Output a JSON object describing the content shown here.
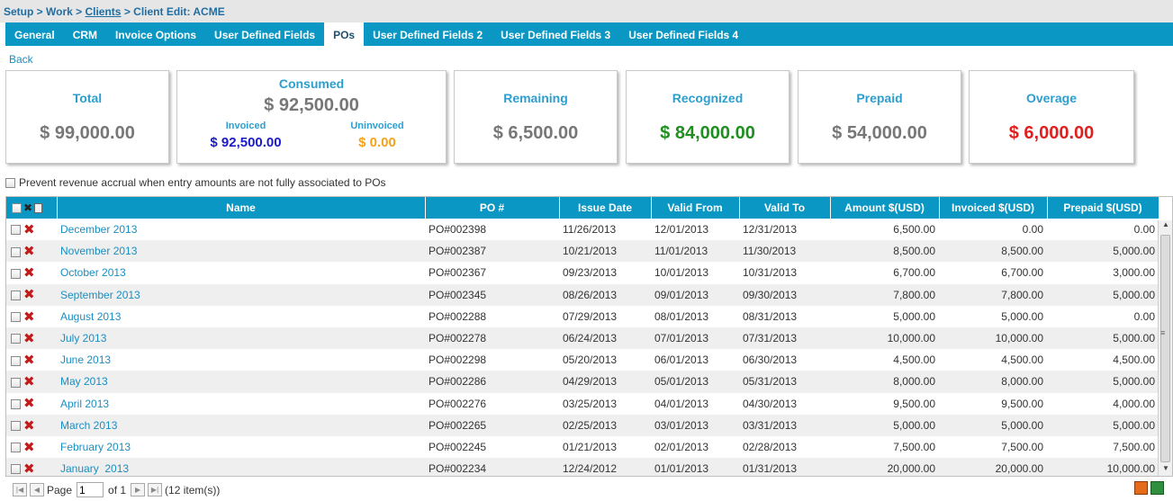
{
  "breadcrumb": {
    "part1": "Setup > Work > ",
    "link": "Clients",
    "part2": " > Client Edit: ACME"
  },
  "tabs": [
    {
      "label": "General",
      "active": false
    },
    {
      "label": "CRM",
      "active": false
    },
    {
      "label": "Invoice Options",
      "active": false
    },
    {
      "label": "User Defined Fields",
      "active": false
    },
    {
      "label": "POs",
      "active": true
    },
    {
      "label": "User Defined Fields 2",
      "active": false
    },
    {
      "label": "User Defined Fields 3",
      "active": false
    },
    {
      "label": "User Defined Fields 4",
      "active": false
    }
  ],
  "back_label": "Back",
  "summary": {
    "total": {
      "title": "Total",
      "value": "$ 99,000.00"
    },
    "consumed": {
      "title": "Consumed",
      "value": "$ 92,500.00",
      "invoiced_label": "Invoiced",
      "invoiced_value": "$ 92,500.00",
      "uninvoiced_label": "Uninvoiced",
      "uninvoiced_value": "$ 0.00"
    },
    "remaining": {
      "title": "Remaining",
      "value": "$ 6,500.00"
    },
    "recognized": {
      "title": "Recognized",
      "value": "$ 84,000.00"
    },
    "prepaid": {
      "title": "Prepaid",
      "value": "$ 54,000.00"
    },
    "overage": {
      "title": "Overage",
      "value": "$ 6,000.00"
    }
  },
  "colors": {
    "accent": "#0b97c4",
    "invoiced": "#1a1ac8",
    "uninvoiced": "#f3a21c",
    "recognized": "#1f8f1f",
    "overage": "#e0201e",
    "neutral_value": "#777777"
  },
  "prevent_checkbox_label": "Prevent revenue accrual when entry amounts are not fully associated to POs",
  "table": {
    "headers": [
      "Name",
      "PO #",
      "Issue Date",
      "Valid From",
      "Valid To",
      "Amount $(USD)",
      "Invoiced $(USD)",
      "Prepaid $(USD)"
    ],
    "rows": [
      {
        "name": "December 2013",
        "po": "PO#002398",
        "issue": "11/26/2013",
        "from": "12/01/2013",
        "to": "12/31/2013",
        "amount": "6,500.00",
        "invoiced": "0.00",
        "prepaid": "0.00"
      },
      {
        "name": "November 2013",
        "po": "PO#002387",
        "issue": "10/21/2013",
        "from": "11/01/2013",
        "to": "11/30/2013",
        "amount": "8,500.00",
        "invoiced": "8,500.00",
        "prepaid": "5,000.00"
      },
      {
        "name": "October 2013",
        "po": "PO#002367",
        "issue": "09/23/2013",
        "from": "10/01/2013",
        "to": "10/31/2013",
        "amount": "6,700.00",
        "invoiced": "6,700.00",
        "prepaid": "3,000.00"
      },
      {
        "name": "September 2013",
        "po": "PO#002345",
        "issue": "08/26/2013",
        "from": "09/01/2013",
        "to": "09/30/2013",
        "amount": "7,800.00",
        "invoiced": "7,800.00",
        "prepaid": "5,000.00"
      },
      {
        "name": "August 2013",
        "po": "PO#002288",
        "issue": "07/29/2013",
        "from": "08/01/2013",
        "to": "08/31/2013",
        "amount": "5,000.00",
        "invoiced": "5,000.00",
        "prepaid": "0.00"
      },
      {
        "name": "July 2013",
        "po": "PO#002278",
        "issue": "06/24/2013",
        "from": "07/01/2013",
        "to": "07/31/2013",
        "amount": "10,000.00",
        "invoiced": "10,000.00",
        "prepaid": "5,000.00"
      },
      {
        "name": "June 2013",
        "po": "PO#002298",
        "issue": "05/20/2013",
        "from": "06/01/2013",
        "to": "06/30/2013",
        "amount": "4,500.00",
        "invoiced": "4,500.00",
        "prepaid": "4,500.00"
      },
      {
        "name": "May 2013",
        "po": "PO#002286",
        "issue": "04/29/2013",
        "from": "05/01/2013",
        "to": "05/31/2013",
        "amount": "8,000.00",
        "invoiced": "8,000.00",
        "prepaid": "5,000.00"
      },
      {
        "name": "April 2013",
        "po": "PO#002276",
        "issue": "03/25/2013",
        "from": "04/01/2013",
        "to": "04/30/2013",
        "amount": "9,500.00",
        "invoiced": "9,500.00",
        "prepaid": "4,000.00"
      },
      {
        "name": "March 2013",
        "po": "PO#002265",
        "issue": "02/25/2013",
        "from": "03/01/2013",
        "to": "03/31/2013",
        "amount": "5,000.00",
        "invoiced": "5,000.00",
        "prepaid": "5,000.00"
      },
      {
        "name": "February 2013",
        "po": "PO#002245",
        "issue": "01/21/2013",
        "from": "02/01/2013",
        "to": "02/28/2013",
        "amount": "7,500.00",
        "invoiced": "7,500.00",
        "prepaid": "7,500.00"
      },
      {
        "name": "January  2013",
        "po": "PO#002234",
        "issue": "12/24/2012",
        "from": "01/01/2013",
        "to": "01/31/2013",
        "amount": "20,000.00",
        "invoiced": "20,000.00",
        "prepaid": "10,000.00"
      }
    ]
  },
  "pager": {
    "page_label": "Page",
    "page_value": "1",
    "of_label": "of 1",
    "count_label": "(12 item(s))"
  }
}
